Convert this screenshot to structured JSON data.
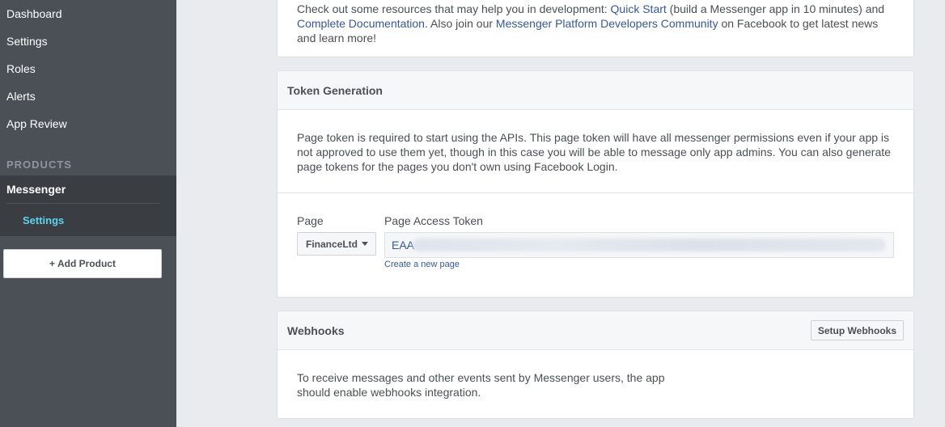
{
  "sidebar": {
    "items": [
      {
        "label": "Dashboard"
      },
      {
        "label": "Settings"
      },
      {
        "label": "Roles"
      },
      {
        "label": "Alerts"
      },
      {
        "label": "App Review"
      }
    ],
    "products_label": "PRODUCTS",
    "messenger": {
      "label": "Messenger",
      "settings_label": "Settings"
    },
    "add_product_label": "+ Add Product"
  },
  "intro": {
    "text_before": "Check out some resources that may help you in development: ",
    "quick_start_link": "Quick Start",
    "text_mid1": " (build a Messenger app in 10 minutes) and ",
    "docs_link": "Complete Documentation",
    "text_mid2": ". Also join our ",
    "community_link": "Messenger Platform Developers Community",
    "text_after": " on Facebook to get latest news and learn more!"
  },
  "token_generation": {
    "title": "Token Generation",
    "description": "Page token is required to start using the APIs. This page token will have all messenger permissions even if your app is not approved to use them yet, though in this case you will be able to message only app admins. You can also generate page tokens for the pages you don't own using Facebook Login.",
    "page_label": "Page",
    "page_value": "FinanceLtd",
    "token_label": "Page Access Token",
    "token_value": "EAA",
    "create_page_link": "Create a new page"
  },
  "webhooks": {
    "title": "Webhooks",
    "setup_button": "Setup Webhooks",
    "description": "To receive messages and other events sent by Messenger users, the app should enable webhooks integration."
  }
}
